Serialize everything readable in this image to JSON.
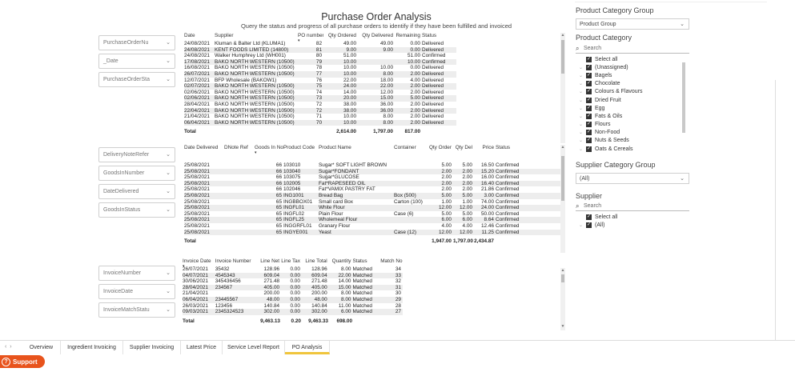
{
  "title": "Purchase Order Analysis",
  "subtitle": "Query the status and progress of all purchase orders to identify if they have been fulfilled and invoiced",
  "slicers": [
    "PurchaseOrderNu",
    "_Date",
    "PurchaseOrderSta",
    "DeliveryNoteRefer",
    "GoodsInNumber",
    "DateDelivered",
    "GoodsInStatus",
    "InvoiceNumber",
    "InvoiceDate",
    "InvoiceMatchStatu"
  ],
  "po_table": {
    "headers": [
      "Date",
      "Supplier",
      "PO number",
      "Qty Ordered",
      "Qty Delivered",
      "Remaining",
      "Status"
    ],
    "rows": [
      [
        "24/08/2021",
        "Kluman & Balter Ltd (KLUMA1)",
        "82",
        "49.00",
        "49.00",
        "0.00",
        "Delivered"
      ],
      [
        "24/08/2021",
        "KENT FOODS LIMITED (14800)",
        "81",
        "9.00",
        "9.00",
        "0.00",
        "Delivered"
      ],
      [
        "24/08/2021",
        "Walker Humphrey Ltd (WH001)",
        "80",
        "51.00",
        "",
        "51.00",
        "Confirmed"
      ],
      [
        "17/08/2021",
        "BAKO NORTH WESTERN (10500)",
        "79",
        "10.00",
        "",
        "10.00",
        "Confirmed"
      ],
      [
        "16/08/2021",
        "BAKO NORTH WESTERN (10500)",
        "78",
        "10.00",
        "10.00",
        "0.00",
        "Delivered"
      ],
      [
        "26/07/2021",
        "BAKO NORTH WESTERN (10500)",
        "77",
        "10.00",
        "8.00",
        "2.00",
        "Delivered"
      ],
      [
        "12/07/2021",
        "BFP Wholesale (BAKOW1)",
        "76",
        "22.00",
        "18.00",
        "4.00",
        "Delivered"
      ],
      [
        "02/07/2021",
        "BAKO NORTH WESTERN (10500)",
        "75",
        "24.00",
        "22.00",
        "2.00",
        "Delivered"
      ],
      [
        "02/06/2021",
        "BAKO NORTH WESTERN (10500)",
        "74",
        "14.00",
        "12.00",
        "2.00",
        "Delivered"
      ],
      [
        "02/06/2021",
        "BAKO NORTH WESTERN (10500)",
        "73",
        "20.00",
        "15.00",
        "5.00",
        "Delivered"
      ],
      [
        "28/04/2021",
        "BAKO NORTH WESTERN (10500)",
        "72",
        "38.00",
        "36.00",
        "2.00",
        "Delivered"
      ],
      [
        "22/04/2021",
        "BAKO NORTH WESTERN (10500)",
        "72",
        "38.00",
        "36.00",
        "2.00",
        "Delivered"
      ],
      [
        "21/04/2021",
        "BAKO NORTH WESTERN (10500)",
        "71",
        "10.00",
        "8.00",
        "2.00",
        "Delivered"
      ],
      [
        "06/04/2021",
        "BAKO NORTH WESTERN (10500)",
        "70",
        "10.00",
        "8.00",
        "2.00",
        "Delivered"
      ]
    ],
    "total_label": "Total",
    "totals": [
      "2,614.00",
      "1,797.00",
      "817.00"
    ]
  },
  "gi_table": {
    "headers": [
      "Date Delivered",
      "DNote Ref",
      "Goods In No",
      "Product Code",
      "Product Name",
      "Container",
      "Qty Order",
      "Qty Del",
      "Price",
      "Status"
    ],
    "rows": [
      [
        "25/08/2021",
        "",
        "66",
        "103010",
        "Sugar* SOFT LIGHT BROWN",
        "",
        "5.00",
        "5.00",
        "16.50",
        "Confirmed"
      ],
      [
        "25/08/2021",
        "",
        "66",
        "103040",
        "Sugar*FONDANT",
        "",
        "2.00",
        "2.00",
        "15.20",
        "Confirmed"
      ],
      [
        "25/08/2021",
        "",
        "66",
        "103075",
        "Sugar*GLUCOSE",
        "",
        "2.00",
        "2.00",
        "16.00",
        "Confirmed"
      ],
      [
        "25/08/2021",
        "",
        "66",
        "102005",
        "Fat*RAPESEED OIL",
        "",
        "2.00",
        "2.00",
        "16.40",
        "Confirmed"
      ],
      [
        "25/08/2021",
        "",
        "66",
        "102046",
        "Fat*VAMIX PASTRY FAT",
        "",
        "2.00",
        "2.00",
        "21.86",
        "Confirmed"
      ],
      [
        "25/08/2021",
        "",
        "65",
        "ING1001",
        "Bread Bag",
        "Box (500)",
        "5.00",
        "5.00",
        "3.00",
        "Confirmed"
      ],
      [
        "25/08/2021",
        "",
        "65",
        "INGBBOX01",
        "Small card Box",
        "Carton (100)",
        "1.00",
        "1.00",
        "74.00",
        "Confirmed"
      ],
      [
        "25/08/2021",
        "",
        "65",
        "INGFL01",
        "White Flour",
        "",
        "12.00",
        "12.00",
        "24.00",
        "Confirmed"
      ],
      [
        "25/08/2021",
        "",
        "65",
        "INGFL02",
        "Plain Flour",
        "Case (6)",
        "5.00",
        "5.00",
        "50.00",
        "Confirmed"
      ],
      [
        "25/08/2021",
        "",
        "65",
        "INGFL25",
        "Wholemeal Flour",
        "",
        "6.00",
        "6.00",
        "8.64",
        "Confirmed"
      ],
      [
        "25/08/2021",
        "",
        "65",
        "INGGRFL01",
        "Granary Flour",
        "",
        "4.00",
        "4.00",
        "12.46",
        "Confirmed"
      ],
      [
        "25/08/2021",
        "",
        "65",
        "INGYE001",
        "Yeast",
        "Case (12)",
        "12.00",
        "12.00",
        "11.25",
        "Confirmed"
      ]
    ],
    "total_label": "Total",
    "totals": [
      "1,947.00",
      "1,797.00",
      "2,434.87"
    ]
  },
  "inv_table": {
    "headers": [
      "Invoice Date",
      "Invoice Number",
      "Line Net",
      "Line Tax",
      "Line Total",
      "Quantity",
      "Status",
      "Match No"
    ],
    "rows": [
      [
        "26/07/2021",
        "35432",
        "128.96",
        "0.00",
        "128.96",
        "8.00",
        "Matched",
        "34"
      ],
      [
        "04/07/2021",
        "4545343",
        "609.04",
        "0.00",
        "609.04",
        "22.00",
        "Matched",
        "33"
      ],
      [
        "30/06/2021",
        "345436456",
        "271.48",
        "0.00",
        "271.48",
        "14.00",
        "Matched",
        "32"
      ],
      [
        "28/04/2021",
        "234567",
        "405.00",
        "0.00",
        "405.00",
        "15.00",
        "Matched",
        "31"
      ],
      [
        "21/04/2021",
        "",
        "200.00",
        "0.00",
        "200.00",
        "8.00",
        "Matched",
        "30"
      ],
      [
        "06/04/2021",
        "23445567",
        "48.00",
        "0.00",
        "48.00",
        "8.00",
        "Matched",
        "29"
      ],
      [
        "26/03/2021",
        "123456",
        "140.84",
        "0.00",
        "140.84",
        "11.00",
        "Matched",
        "28"
      ],
      [
        "09/03/2021",
        "2345324523",
        "302.00",
        "0.00",
        "302.00",
        "6.00",
        "Matched",
        "27"
      ]
    ],
    "total_label": "Total",
    "totals": [
      "9,463.13",
      "0.20",
      "9,463.33",
      "698.00"
    ]
  },
  "filters": {
    "product_group_title": "Product Category Group",
    "product_group_value": "Product Group",
    "product_category_title": "Product Category",
    "search_placeholder": "Search",
    "categories": [
      "Select all",
      "(Unassigned)",
      "Bagels",
      "Chocolate",
      "Colours & Flavours",
      "Dried Fruit",
      "Egg",
      "Fats & Oils",
      "Flours",
      "Non-Food",
      "Nuts & Seeds",
      "Oats & Cereals"
    ],
    "supplier_group_title": "Supplier Category Group",
    "supplier_group_value": "(All)",
    "supplier_title": "Supplier",
    "suppliers": [
      "Select all",
      "(All)"
    ]
  },
  "tabs": [
    "Overview",
    "Ingredient Invoicing",
    "Supplier Invoicing",
    "Latest Price",
    "Service Level Report",
    "PO Analysis"
  ],
  "active_tab": "PO Analysis",
  "support_label": "Support",
  "colors": {
    "accent_tab": "#f0c53c",
    "support": "#e8531c"
  }
}
